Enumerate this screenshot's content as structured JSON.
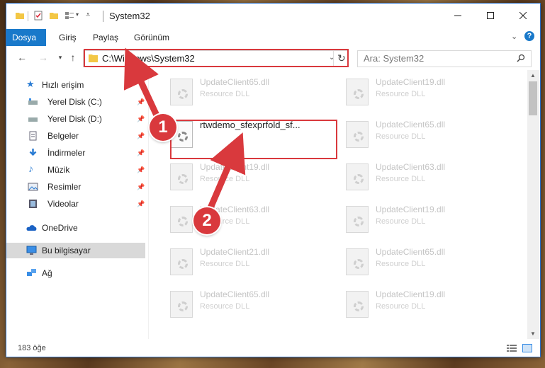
{
  "window": {
    "title": "System32"
  },
  "ribbon": {
    "tabs": [
      {
        "label": "Dosya",
        "active": true
      },
      {
        "label": "Giriş"
      },
      {
        "label": "Paylaş"
      },
      {
        "label": "Görünüm"
      }
    ]
  },
  "address": {
    "path": "C:\\Windows\\System32"
  },
  "search": {
    "placeholder": "Ara: System32"
  },
  "sidebar": {
    "items": [
      {
        "label": "Hızlı erişim",
        "icon": "star-icon"
      },
      {
        "label": "Yerel Disk (C:)",
        "icon": "drive-icon",
        "pinned": true
      },
      {
        "label": "Yerel Disk (D:)",
        "icon": "drive-icon",
        "pinned": true
      },
      {
        "label": "Belgeler",
        "icon": "documents-icon",
        "pinned": true
      },
      {
        "label": "İndirmeler",
        "icon": "download-icon",
        "pinned": true
      },
      {
        "label": "Müzik",
        "icon": "music-icon",
        "pinned": true
      },
      {
        "label": "Resimler",
        "icon": "pictures-icon",
        "pinned": true
      },
      {
        "label": "Videolar",
        "icon": "videos-icon",
        "pinned": true
      },
      {
        "label": "OneDrive",
        "icon": "cloud-icon"
      },
      {
        "label": "Bu bilgisayar",
        "icon": "computer-icon",
        "selected": true
      },
      {
        "label": "Ağ",
        "icon": "network-icon"
      }
    ]
  },
  "files": [
    {
      "name": "UpdateClient65.dll",
      "type": "Resource DLL"
    },
    {
      "name": "UpdateClient19.dll",
      "type": "Resource DLL"
    },
    {
      "name": "rtwdemo_sfexprfold_sf...",
      "type": ""
    },
    {
      "name": "UpdateClient65.dll",
      "type": "Resource DLL"
    },
    {
      "name": "UpdateClient19.dll",
      "type": "Resource DLL"
    },
    {
      "name": "UpdateClient63.dll",
      "type": "Resource DLL"
    },
    {
      "name": "UpdateClient63.dll",
      "type": "Resource DLL"
    },
    {
      "name": "UpdateClient19.dll",
      "type": "Resource DLL"
    },
    {
      "name": "UpdateClient21.dll",
      "type": "Resource DLL"
    },
    {
      "name": "UpdateClient65.dll",
      "type": "Resource DLL"
    },
    {
      "name": "UpdateClient65.dll",
      "type": "Resource DLL"
    },
    {
      "name": "UpdateClient19.dll",
      "type": "Resource DLL"
    }
  ],
  "status": {
    "count": "183 öğe"
  },
  "callouts": {
    "step1": "1",
    "step2": "2"
  },
  "colors": {
    "accent": "#1979ca",
    "highlight": "#d9393d"
  }
}
